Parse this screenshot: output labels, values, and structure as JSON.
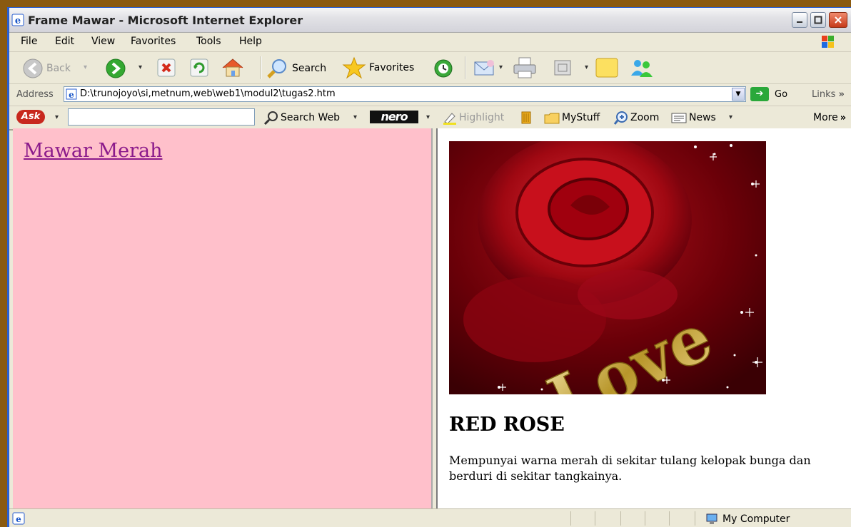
{
  "window": {
    "title": "Frame Mawar - Microsoft Internet Explorer"
  },
  "menu": [
    "File",
    "Edit",
    "View",
    "Favorites",
    "Tools",
    "Help"
  ],
  "toolbar": {
    "back": "Back",
    "search": "Search",
    "favorites": "Favorites"
  },
  "address": {
    "label": "Address",
    "url": "D:\\trunojoyo\\si,metnum,web\\web1\\modul2\\tugas2.htm",
    "go": "Go",
    "links": "Links"
  },
  "ask_toolbar": {
    "logo": "Ask",
    "search_value": "",
    "search_web": "Search Web",
    "nero": "nero",
    "highlight": "Highlight",
    "mystuff": "MyStuff",
    "zoom": "Zoom",
    "news": "News",
    "more": "More"
  },
  "left_frame": {
    "link": "Mawar Merah"
  },
  "right_frame": {
    "image_text": "Love",
    "heading": "RED ROSE",
    "description": "Mempunyai warna merah di sekitar tulang kelopak bunga dan berduri di sekitar tangkainya."
  },
  "status": {
    "zone": "My Computer"
  },
  "colors": {
    "left_bg": "#ffc0cb",
    "link": "#8b1a8b",
    "desktop": "#8a5a10"
  }
}
